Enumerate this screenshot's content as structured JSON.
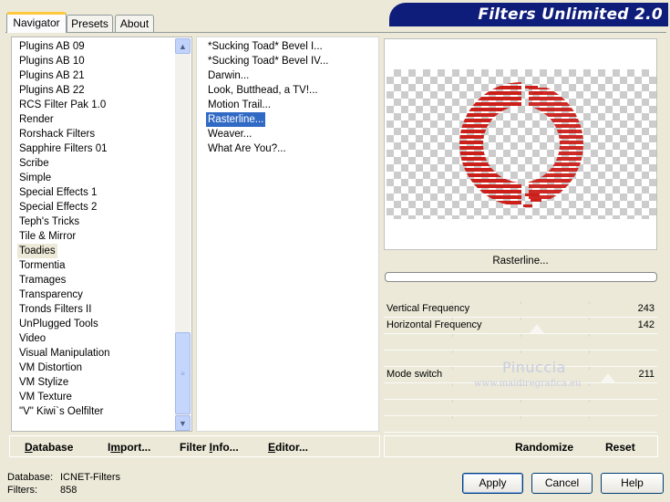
{
  "tabs": [
    {
      "label": "Navigator",
      "active": true
    },
    {
      "label": "Presets",
      "active": false
    },
    {
      "label": "About",
      "active": false
    }
  ],
  "banner": {
    "title": "Filters Unlimited 2.0"
  },
  "categories": {
    "items": [
      "Plugins AB 09",
      "Plugins AB 10",
      "Plugins AB 21",
      "Plugins AB 22",
      "RCS Filter Pak 1.0",
      "Render",
      "Rorshack Filters",
      "Sapphire Filters 01",
      "Scribe",
      "Simple",
      "Special Effects 1",
      "Special Effects 2",
      "Teph's Tricks",
      "Tile & Mirror",
      "Toadies",
      "Tormentia",
      "Tramages",
      "Transparency",
      "Tronds Filters II",
      "UnPlugged Tools",
      "Video",
      "Visual Manipulation",
      "VM Distortion",
      "VM Stylize",
      "VM Texture",
      "\"V\" Kiwi`s Oelfilter"
    ],
    "selected": "Toadies"
  },
  "filters": {
    "items": [
      "*Sucking Toad*  Bevel I...",
      "*Sucking Toad*  Bevel IV...",
      "Darwin...",
      "Look, Butthead, a TV!...",
      "Motion Trail...",
      "Rasterline...",
      "Weaver...",
      "What Are You?..."
    ],
    "selected": "Rasterline..."
  },
  "preview": {
    "filter_name": "Rasterline...",
    "progress": 0
  },
  "sliders": [
    {
      "label": "Vertical Frequency",
      "value": "243"
    },
    {
      "label": "Horizontal Frequency",
      "value": "142"
    },
    {
      "label": "",
      "value": ""
    },
    {
      "label": "",
      "value": ""
    },
    {
      "label": "Mode switch",
      "value": "211"
    },
    {
      "label": "",
      "value": ""
    },
    {
      "label": "",
      "value": ""
    },
    {
      "label": "",
      "value": ""
    }
  ],
  "toolbar": {
    "database_u": "D",
    "database_rest": "atabase",
    "import_pre": "I",
    "import_u": "m",
    "import_rest": "port...",
    "filterinfo_pre": "Filter ",
    "filterinfo_u": "I",
    "filterinfo_rest": "nfo...",
    "editor_u": "E",
    "editor_rest": "ditor...",
    "randomize": "Randomize",
    "reset": "Reset"
  },
  "status": {
    "database_label": "Database:",
    "database_value": "ICNET-Filters",
    "filters_label": "Filters:",
    "filters_value": "858"
  },
  "buttons": {
    "apply": "Apply",
    "cancel": "Cancel",
    "help": "Help"
  },
  "watermark": {
    "line1": "Pinuccia",
    "line2": "www.maidiregrafica.eu"
  },
  "colors": {
    "banner": "#0f1d7a",
    "selection": "#316ac5",
    "preview_red": "#cc1f1a"
  }
}
